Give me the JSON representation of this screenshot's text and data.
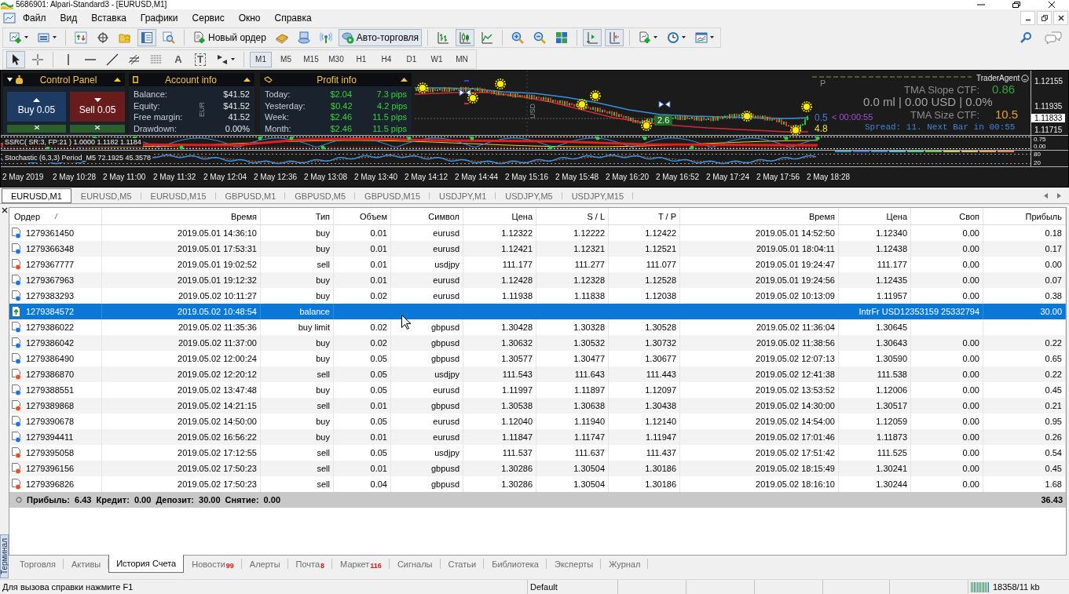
{
  "window": {
    "title": "5686901: Alpari-Standard3 - [EURUSD,M1]"
  },
  "menu": [
    "Файл",
    "Вид",
    "Вставка",
    "Графики",
    "Сервис",
    "Окно",
    "Справка"
  ],
  "main_toolbar": [
    [
      {
        "kind": "new-chart",
        "pressed": false
      },
      {
        "kind": "profiles",
        "pressed": false
      }
    ],
    [
      {
        "kind": "market-watch",
        "pressed": false
      },
      {
        "kind": "data-window",
        "pressed": false
      },
      {
        "kind": "navigator",
        "pressed": false
      },
      {
        "kind": "terminal",
        "pressed": true
      },
      {
        "kind": "tester",
        "pressed": false
      }
    ],
    [
      {
        "kind": "new-order",
        "label": "Новый ордер",
        "pressed": false
      },
      {
        "kind": "metaeditor",
        "pressed": false
      },
      {
        "kind": "signals",
        "pressed": false
      },
      {
        "kind": "market",
        "pressed": false
      },
      {
        "kind": "autotrading",
        "label": "Авто-торговля",
        "pressed": true
      }
    ],
    [
      {
        "kind": "bar-chart",
        "pressed": false
      },
      {
        "kind": "candles",
        "pressed": true
      },
      {
        "kind": "line-chart",
        "pressed": false
      }
    ],
    [
      {
        "kind": "zoom-in",
        "pressed": false
      },
      {
        "kind": "zoom-out",
        "pressed": false
      },
      {
        "kind": "tile",
        "pressed": false
      }
    ],
    [
      {
        "kind": "autoscroll",
        "pressed": true
      },
      {
        "kind": "chart-shift",
        "pressed": true
      }
    ],
    [
      {
        "kind": "indicators",
        "pressed": false
      },
      {
        "kind": "periods",
        "pressed": false
      },
      {
        "kind": "templates",
        "pressed": false
      }
    ]
  ],
  "drawing_toolbar": {
    "tools": [
      [
        {
          "kind": "cursor",
          "selected": true
        },
        {
          "kind": "crosshair",
          "selected": false
        }
      ],
      [
        {
          "kind": "vertical-line",
          "selected": false
        },
        {
          "kind": "horizontal-line",
          "selected": false
        },
        {
          "kind": "trend-line",
          "selected": false
        },
        {
          "kind": "fibo-channel",
          "selected": false
        },
        {
          "kind": "fibo-levels",
          "selected": false
        },
        {
          "kind": "text",
          "glyph": "A",
          "selected": false
        },
        {
          "kind": "label",
          "glyph": "T",
          "selected": false
        },
        {
          "kind": "arrows",
          "selected": false
        }
      ]
    ],
    "periods": [
      {
        "label": "M1",
        "selected": true
      },
      {
        "label": "M5",
        "selected": false
      },
      {
        "label": "M15",
        "selected": false
      },
      {
        "label": "M30",
        "selected": false
      },
      {
        "label": "H1",
        "selected": false
      },
      {
        "label": "H4",
        "selected": false
      },
      {
        "label": "D1",
        "selected": false
      },
      {
        "label": "W1",
        "selected": false
      },
      {
        "label": "MN",
        "selected": false
      }
    ]
  },
  "chart": {
    "control_panel": {
      "title": "Control Panel",
      "buy": "Buy 0.05",
      "sell": "Sell 0.05"
    },
    "account_info": {
      "title": "Account info",
      "currency_mark": "EUR",
      "rows": [
        {
          "label": "Balance:",
          "value": "$41.52"
        },
        {
          "label": "Equity:",
          "value": "$41.52"
        },
        {
          "label": "Free margin:",
          "value": "41.52"
        },
        {
          "label": "Drawdown:",
          "value": "0.00%"
        }
      ]
    },
    "profit_info": {
      "title": "Profit info",
      "rows": [
        {
          "label": "Today:",
          "amount": "$2.04",
          "pips": "7.3 pips"
        },
        {
          "label": "Yesterday:",
          "amount": "$0.42",
          "pips": "4.2 pips"
        },
        {
          "label": "Week:",
          "amount": "$2.46",
          "pips": "11.5 pips"
        },
        {
          "label": "Month:",
          "amount": "$2.46",
          "pips": "11.5 pips"
        }
      ]
    },
    "currency_mark": "USD",
    "trader_agent": "TraderAgent",
    "pivot_label": "P",
    "trade_label": "2.6",
    "tma_slope": {
      "label": "TMA Slope CTF:",
      "value": "0.86"
    },
    "account_summary": "0.0 ml | 0.00 USD | 0.0%",
    "tma_size": {
      "label": "TMA Size CTF:",
      "value": "10.5"
    },
    "candle_range": "0.5",
    "countdown": "< 00:00:55",
    "spread": "Spread: 11. Next Bar in 00:55",
    "range_value": "4.8",
    "price_axis": [
      {
        "label": "1.12155",
        "current": false
      },
      {
        "label": "1.11935",
        "current": false
      },
      {
        "label": "1.11833",
        "current": true
      },
      {
        "label": "1.11715",
        "current": false
      }
    ],
    "indicators": [
      {
        "kind": "ssrc",
        "title": "SSRC( SR:3, FP:21 ) 1.0000 1.1182 1.1184",
        "axis": [
          "0.75",
          "0.00"
        ]
      },
      {
        "kind": "stochastic",
        "title": "Stochastic (6,3,3) Period_M5 72.1925 45.3578",
        "axis": [
          "80",
          "20"
        ]
      }
    ],
    "time_axis": [
      "2 May 2019",
      "2 May 10:28",
      "2 May 11:00",
      "2 May 11:32",
      "2 May 12:04",
      "2 May 12:36",
      "2 May 13:08",
      "2 May 13:40",
      "2 May 14:12",
      "2 May 14:44",
      "2 May 15:16",
      "2 May 15:48",
      "2 May 16:20",
      "2 May 16:52",
      "2 May 17:24",
      "2 May 17:56",
      "2 May 18:28"
    ]
  },
  "chart_tabs": [
    {
      "label": "EURUSD,M1",
      "selected": true
    },
    {
      "label": "EURUSD,M5",
      "selected": false
    },
    {
      "label": "EURUSD,M15",
      "selected": false
    },
    {
      "label": "GBPUSD,M1",
      "selected": false
    },
    {
      "label": "GBPUSD,M5",
      "selected": false
    },
    {
      "label": "GBPUSD,M15",
      "selected": false
    },
    {
      "label": "USDJPY,M1",
      "selected": false
    },
    {
      "label": "USDJPY,M5",
      "selected": false
    },
    {
      "label": "USDJPY,M15",
      "selected": false
    }
  ],
  "terminal": {
    "title": "Терминал",
    "columns": [
      {
        "label": "Ордер",
        "sorted": true
      },
      {
        "label": "Время",
        "sorted": false
      },
      {
        "label": "Тип",
        "sorted": false
      },
      {
        "label": "Объем",
        "sorted": false
      },
      {
        "label": "Символ",
        "sorted": false
      },
      {
        "label": "Цена",
        "sorted": false
      },
      {
        "label": "S / L",
        "sorted": false
      },
      {
        "label": "T / P",
        "sorted": false
      },
      {
        "label": "Время",
        "sorted": false
      },
      {
        "label": "Цена",
        "sorted": false
      },
      {
        "label": "Своп",
        "sorted": false
      },
      {
        "label": "Прибыль",
        "sorted": false
      }
    ],
    "rows": [
      {
        "kind": "buy",
        "selected": false,
        "cells": [
          "1279361450",
          "2019.05.01 14:36:10",
          "buy",
          "0.01",
          "eurusd",
          "1.12322",
          "1.12222",
          "1.12422",
          "2019.05.01 14:52:50",
          "1.12340",
          "0.00",
          "0.18"
        ]
      },
      {
        "kind": "buy",
        "selected": false,
        "cells": [
          "1279366348",
          "2019.05.01 17:53:31",
          "buy",
          "0.01",
          "eurusd",
          "1.12421",
          "1.12321",
          "1.12521",
          "2019.05.01 18:04:11",
          "1.12438",
          "0.00",
          "0.17"
        ]
      },
      {
        "kind": "sell",
        "selected": false,
        "cells": [
          "1279367777",
          "2019.05.01 19:02:52",
          "sell",
          "0.01",
          "usdjpy",
          "111.177",
          "111.277",
          "111.077",
          "2019.05.01 19:24:47",
          "111.177",
          "0.00",
          "0.00"
        ]
      },
      {
        "kind": "buy",
        "selected": false,
        "cells": [
          "1279367963",
          "2019.05.01 19:12:32",
          "buy",
          "0.01",
          "eurusd",
          "1.12428",
          "1.12328",
          "1.12528",
          "2019.05.01 19:24:56",
          "1.12435",
          "0.00",
          "0.07"
        ]
      },
      {
        "kind": "buy",
        "selected": false,
        "cells": [
          "1279383293",
          "2019.05.02 10:11:27",
          "buy",
          "0.02",
          "eurusd",
          "1.11938",
          "1.11838",
          "1.12038",
          "2019.05.02 10:13:09",
          "1.11957",
          "0.00",
          "0.38"
        ]
      },
      {
        "kind": "balance",
        "selected": true,
        "cells": [
          "1279384572",
          "2019.05.02 10:48:54",
          "balance"
        ],
        "comment": "IntrFr USD12353159 25332794",
        "profit": "30.00"
      },
      {
        "kind": "buy",
        "selected": false,
        "cells": [
          "1279386022",
          "2019.05.02 11:35:36",
          "buy limit",
          "0.02",
          "gbpusd",
          "1.30428",
          "1.30328",
          "1.30528",
          "2019.05.02 11:36:04",
          "1.30645"
        ]
      },
      {
        "kind": "buy",
        "selected": false,
        "cells": [
          "1279386042",
          "2019.05.02 11:37:00",
          "buy",
          "0.02",
          "gbpusd",
          "1.30632",
          "1.30532",
          "1.30732",
          "2019.05.02 11:38:56",
          "1.30643",
          "0.00",
          "0.22"
        ]
      },
      {
        "kind": "buy",
        "selected": false,
        "cells": [
          "1279386490",
          "2019.05.02 12:00:24",
          "buy",
          "0.05",
          "gbpusd",
          "1.30577",
          "1.30477",
          "1.30677",
          "2019.05.02 12:07:13",
          "1.30590",
          "0.00",
          "0.65"
        ]
      },
      {
        "kind": "sell",
        "selected": false,
        "cells": [
          "1279386870",
          "2019.05.02 12:20:12",
          "sell",
          "0.05",
          "usdjpy",
          "111.543",
          "111.643",
          "111.443",
          "2019.05.02 12:41:38",
          "111.538",
          "0.00",
          "0.22"
        ]
      },
      {
        "kind": "buy",
        "selected": false,
        "cells": [
          "1279388551",
          "2019.05.02 13:47:48",
          "buy",
          "0.05",
          "eurusd",
          "1.11997",
          "1.11897",
          "1.12097",
          "2019.05.02 13:53:52",
          "1.12006",
          "0.00",
          "0.45"
        ]
      },
      {
        "kind": "sell",
        "selected": false,
        "cells": [
          "1279389868",
          "2019.05.02 14:21:15",
          "sell",
          "0.01",
          "gbpusd",
          "1.30538",
          "1.30638",
          "1.30438",
          "2019.05.02 14:30:00",
          "1.30517",
          "0.00",
          "0.21"
        ]
      },
      {
        "kind": "buy",
        "selected": false,
        "cells": [
          "1279390678",
          "2019.05.02 14:50:00",
          "buy",
          "0.05",
          "eurusd",
          "1.12040",
          "1.11940",
          "1.12140",
          "2019.05.02 14:54:00",
          "1.12059",
          "0.00",
          "0.95"
        ]
      },
      {
        "kind": "buy",
        "selected": false,
        "cells": [
          "1279394411",
          "2019.05.02 16:56:22",
          "buy",
          "0.01",
          "eurusd",
          "1.11847",
          "1.11747",
          "1.11947",
          "2019.05.02 17:01:46",
          "1.11873",
          "0.00",
          "0.26"
        ]
      },
      {
        "kind": "sell",
        "selected": false,
        "cells": [
          "1279395058",
          "2019.05.02 17:12:55",
          "sell",
          "0.05",
          "usdjpy",
          "111.537",
          "111.637",
          "111.437",
          "2019.05.02 17:51:42",
          "111.525",
          "0.00",
          "0.54"
        ]
      },
      {
        "kind": "sell",
        "selected": false,
        "cells": [
          "1279396156",
          "2019.05.02 17:50:23",
          "sell",
          "0.01",
          "gbpusd",
          "1.30286",
          "1.30504",
          "1.30186",
          "2019.05.02 18:15:49",
          "1.30241",
          "0.00",
          "0.45"
        ]
      },
      {
        "kind": "sell",
        "selected": false,
        "cells": [
          "1279396826",
          "2019.05.02 17:50:23",
          "sell",
          "0.04",
          "gbpusd",
          "1.30286",
          "1.30504",
          "1.30186",
          "2019.05.02 18:16:10",
          "1.30244",
          "0.00",
          "1.68"
        ]
      }
    ],
    "summary": {
      "text": "Прибыль: 6.43 Кредит: 0.00 Депозит: 30.00 Снятие: 0.00",
      "total": "36.43"
    },
    "tabs": [
      {
        "label": "Торговля",
        "selected": false
      },
      {
        "label": "Активы",
        "selected": false
      },
      {
        "label": "История Счета",
        "selected": true
      },
      {
        "label": "Новости",
        "badge": "99",
        "selected": false
      },
      {
        "label": "Алерты",
        "selected": false
      },
      {
        "label": "Почта",
        "badge": "8",
        "selected": false
      },
      {
        "label": "Маркет",
        "badge": "116",
        "selected": false
      },
      {
        "label": "Сигналы",
        "selected": false
      },
      {
        "label": "Статьи",
        "selected": false
      },
      {
        "label": "Библиотека",
        "selected": false
      },
      {
        "label": "Эксперты",
        "selected": false
      },
      {
        "label": "Журнал",
        "selected": false
      }
    ]
  },
  "status_bar": {
    "help": "Для вызова справки нажмите F1",
    "profile": "Default",
    "traffic": "18358/11 kb"
  }
}
